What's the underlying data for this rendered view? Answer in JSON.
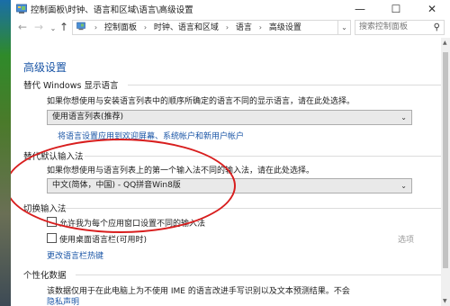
{
  "window": {
    "title": "控制面板\\时钟、语言和区域\\语言\\高级设置",
    "minimize": "—",
    "maximize": "☐",
    "close": "✕"
  },
  "address": {
    "back": "←",
    "forward": "→",
    "recent": "⌄",
    "up": "↑",
    "crumbs": [
      "控制面板",
      "时钟、语言和区域",
      "语言",
      "高级设置"
    ],
    "separator": "›",
    "dropdown": "⌄",
    "refresh": "↻",
    "search_placeholder": "搜索控制面板",
    "search_icon": "⚲"
  },
  "page": {
    "title": "高级设置",
    "display_lang": {
      "header": "替代 Windows 显示语言",
      "desc": "如果你想使用与安装语言列表中的顺序所确定的语言不同的显示语言，请在此处选择。",
      "selected": "使用语言列表(推荐)",
      "apply_link": "将语言设置应用到欢迎屏幕、系统帐户和新用户帐户"
    },
    "default_input": {
      "header": "替代默认输入法",
      "desc": "如果你想使用与语言列表上的第一个输入法不同的输入法，请在此处选择。",
      "selected": "中文(简体，中国) - QQ拼音Win8版"
    },
    "switch_input": {
      "header": "切换输入法",
      "option1": "允许我为每个应用窗口设置不同的输入法",
      "option2": "使用桌面语言栏(可用时)",
      "options_link": "选项",
      "hotkey_link": "更改语言栏热键"
    },
    "personalization": {
      "header": "个性化数据",
      "desc": "该数据仅用于在此电脑上为不使用 IME 的语言改进手写识别以及文本预测结果。不会",
      "privacy_link": "隐私声明"
    }
  },
  "colors": {
    "accent": "#1a55a6",
    "highlight": "#d81e1e"
  }
}
